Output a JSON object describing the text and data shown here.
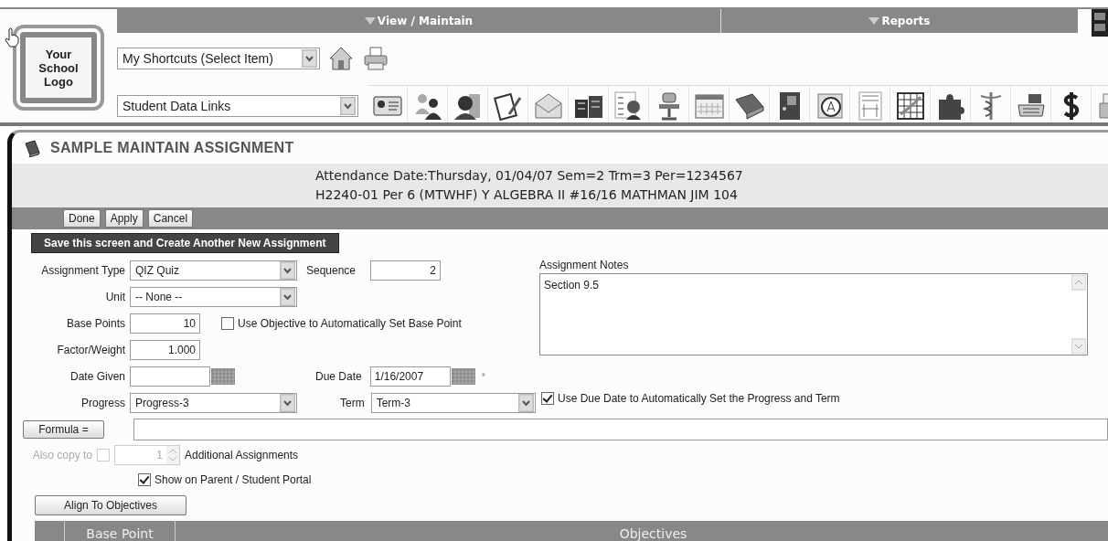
{
  "header": {
    "logo": "Your School Logo",
    "menus": [
      {
        "label": "View / Maintain"
      },
      {
        "label": "Reports"
      }
    ],
    "shortcuts": {
      "value": "My Shortcuts (Select Item)"
    },
    "data_links": {
      "value": "Student Data Links"
    }
  },
  "page": {
    "title": "SAMPLE MAINTAIN ASSIGNMENT",
    "info_lines": [
      "Attendance Date:Thursday, 01/04/07 Sem=2 Trm=3 Per=1234567",
      "H2240-01 Per 6 (MTWHF) Y ALGEBRA II #16/16 MATHMAN JIM 104"
    ],
    "buttons": [
      "Done",
      "Apply",
      "Cancel"
    ],
    "save_button": "Save this screen and Create Another New Assignment"
  },
  "form": {
    "assignment_type": {
      "label": "Assignment Type",
      "value": "QIZ Quiz"
    },
    "sequence": {
      "label": "Sequence",
      "value": "2"
    },
    "unit": {
      "label": "Unit",
      "value": "-- None --"
    },
    "base_points": {
      "label": "Base Points",
      "value": "10"
    },
    "use_objective": {
      "label": "Use Objective to Automatically Set Base Point",
      "checked": false
    },
    "factor_weight": {
      "label": "Factor/Weight",
      "value": "1.000"
    },
    "date_given": {
      "label": "Date Given"
    },
    "due_date": {
      "label": "Due Date",
      "value": "1/16/2007",
      "required_mark": "*"
    },
    "progress": {
      "label": "Progress",
      "value": "Progress-3"
    },
    "term": {
      "label": "Term",
      "value": "Term-3"
    },
    "formula_button": "Formula =",
    "also_copy": {
      "label": "Also copy to",
      "checked": false,
      "disabled": true,
      "count": "1",
      "suffix": "Additional Assignments"
    },
    "show_on_portal": {
      "label": "Show on Parent / Student Portal",
      "checked": true
    },
    "align_button": "Align To Objectives"
  },
  "notes": {
    "label": "Assignment Notes",
    "value": "Section 9.5"
  },
  "use_due_date": {
    "label": "Use Due Date to Automatically Set the Progress and Term",
    "checked": true
  },
  "objectives_table": {
    "columns": [
      {
        "label": "Base Point"
      },
      {
        "label": "Objectives"
      }
    ]
  }
}
